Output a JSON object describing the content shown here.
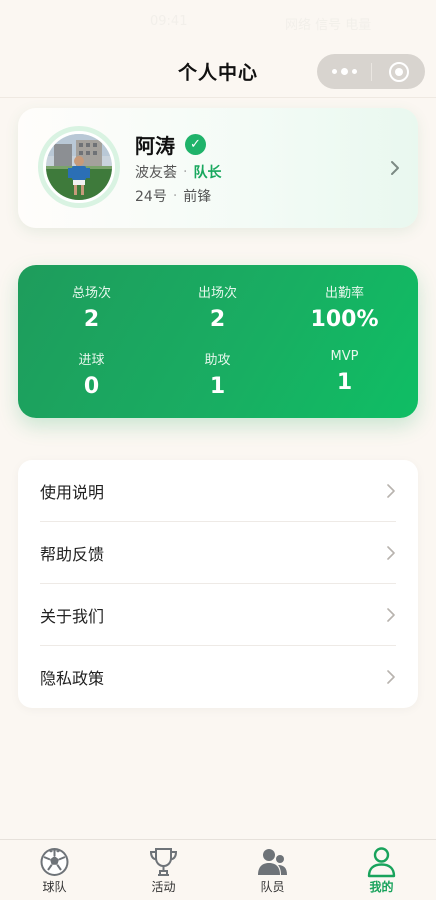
{
  "status_bar": {
    "time": "09:41",
    "right": "网络 信号 电量"
  },
  "nav": {
    "title": "个人中心"
  },
  "profile": {
    "name": "阿涛",
    "team": "波友荟",
    "role": "队长",
    "number": "24号",
    "position": "前锋"
  },
  "stats": [
    {
      "label": "总场次",
      "value": "2"
    },
    {
      "label": "出场次",
      "value": "2"
    },
    {
      "label": "出勤率",
      "value": "100%"
    },
    {
      "label": "进球",
      "value": "0"
    },
    {
      "label": "助攻",
      "value": "1"
    },
    {
      "label": "MVP",
      "value": "1"
    }
  ],
  "menu": [
    {
      "label": "使用说明"
    },
    {
      "label": "帮助反馈"
    },
    {
      "label": "关于我们"
    },
    {
      "label": "隐私政策"
    }
  ],
  "tabs": [
    {
      "label": "球队",
      "icon": "soccer-ball-icon"
    },
    {
      "label": "活动",
      "icon": "trophy-icon"
    },
    {
      "label": "队员",
      "icon": "team-members-icon"
    },
    {
      "label": "我的",
      "icon": "user-profile-icon",
      "active": true
    }
  ],
  "colors": {
    "accent": "#19a35c",
    "background": "#fbf7f2"
  }
}
